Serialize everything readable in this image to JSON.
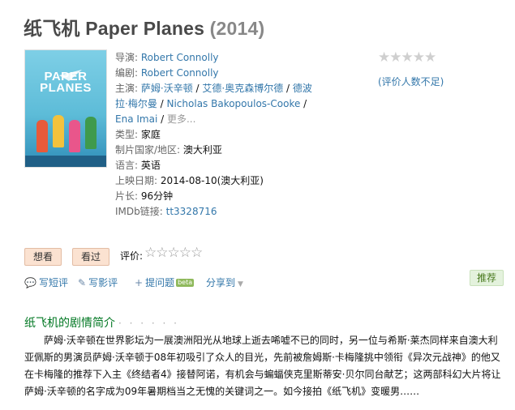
{
  "movie": {
    "title": "纸飞机 Paper Planes",
    "year": "(2014)"
  },
  "poster": {
    "title_line1": "PAPER",
    "title_line2": "PLANES"
  },
  "info": {
    "director_label": "导演:",
    "director": "Robert Connolly",
    "writer_label": "编剧:",
    "writer": "Robert Connolly",
    "cast_label": "主演:",
    "cast": [
      "萨姆·沃辛顿",
      "艾德·奥克森博尔德",
      "德波拉·梅尔曼",
      "Nicholas Bakopoulos-Cooke",
      "Ena Imai"
    ],
    "more": "更多...",
    "genre_label": "类型:",
    "genre": "家庭",
    "country_label": "制片国家/地区:",
    "country": "澳大利亚",
    "language_label": "语言:",
    "language": "英语",
    "release_label": "上映日期:",
    "release": "2014-08-10(澳大利亚)",
    "runtime_label": "片长:",
    "runtime": "96分钟",
    "imdb_label": "IMDb链接:",
    "imdb": "tt3328716"
  },
  "rating": {
    "stars": "★★★★★",
    "note": "(评价人数不足)"
  },
  "buttons": {
    "want": "想看",
    "seen": "看过",
    "rate_label": "评价:",
    "empty_stars": "☆☆☆☆☆"
  },
  "actions": {
    "short_review": "写短评",
    "review": "写影评",
    "ask": "提问题",
    "beta": "beta",
    "share": "分享到",
    "recommend": "推荐"
  },
  "synopsis": {
    "title": "纸飞机的剧情简介",
    "dots": "· · · · · ·",
    "text": "萨姆·沃辛顿在世界影坛为一展澳洲阳光从地球上逝去唏嘘不已的同时，另一位与希斯·莱杰同样来自澳大利亚佩斯的男演员萨姆·沃辛顿于08年初吸引了众人的目光，先前被詹姆斯·卡梅隆挑中领衔《异次元战神》的他又在卡梅隆的推荐下入主《终结者4》接替阿诺，有机会与蝙蝠侠克里斯蒂安·贝尔同台献艺；这两部科幻大片将让萨姆·沃辛顿的名字成为09年暑期档当之无愧的关键词之一。如今接拍《纸飞机》变暖男……"
  }
}
